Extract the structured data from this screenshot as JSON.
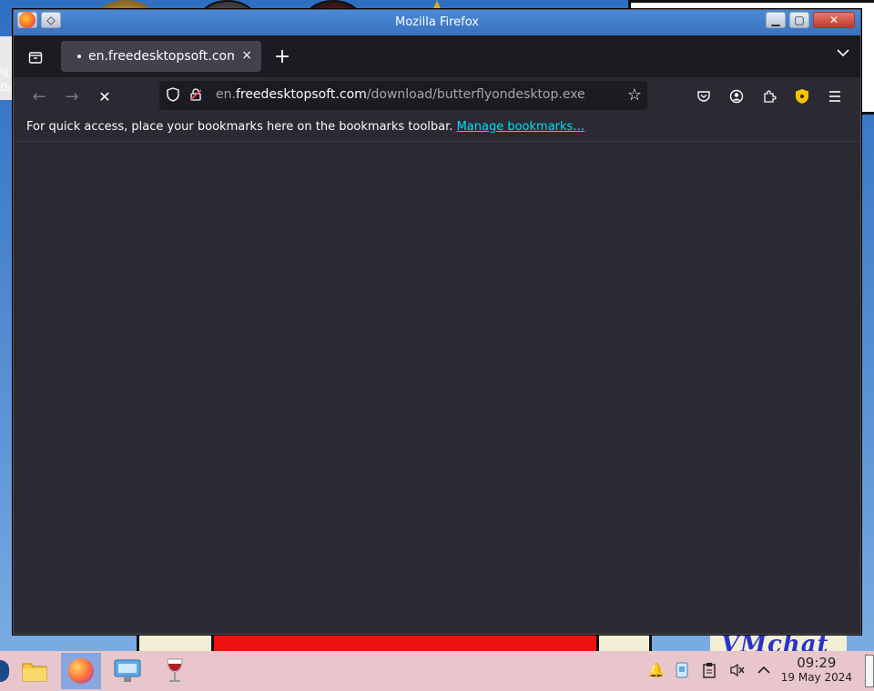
{
  "window": {
    "title": "Mozilla Firefox"
  },
  "tabs": [
    {
      "label": "en.freedesktopsoft.com/download/butterflyondesktop.exe",
      "close": "×"
    }
  ],
  "new_tab_label": "+",
  "navigation": {
    "back": "←",
    "forward": "→",
    "stop": "✕"
  },
  "urlbar": {
    "url_prefix": "en.",
    "url_host": "freedesktopsoft.com",
    "url_path": "/download/butterflyondesktop.exe",
    "bookmark_icon": "☆"
  },
  "toolbar_icons": [
    "pocket-icon",
    "account-icon",
    "extensions-icon",
    "ublock-icon",
    "menu-icon"
  ],
  "bookmarks_bar": {
    "message": "For quick access, place your bookmarks here on the bookmarks toolbar.",
    "link": "Manage bookmarks…"
  },
  "desktop": {
    "side_text_1": "ig",
    "side_text_2": "De",
    "logo_text": "VMchat"
  },
  "taskbar": {
    "apps": [
      "file-manager",
      "firefox",
      "system-settings",
      "wine"
    ],
    "active_app": "firefox",
    "clock": {
      "time": "09:29",
      "date": "19 May 2024"
    }
  },
  "colors": {
    "toolbar_bg": "#2b2a33",
    "tabstrip_bg": "#1c1b22",
    "link": "#00ddff",
    "taskbar_bg": "#e8c6cc"
  }
}
